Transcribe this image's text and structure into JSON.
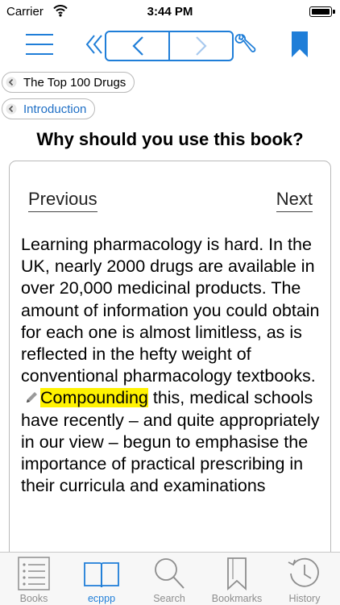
{
  "status_bar": {
    "carrier": "Carrier",
    "time": "3:44 PM"
  },
  "toolbar": {
    "icons": [
      "hamburger-menu-icon",
      "double-chevron-left-icon",
      "chevron-left-icon",
      "chevron-right-icon",
      "wrench-icon",
      "bookmark-icon"
    ]
  },
  "breadcrumbs": [
    {
      "label": "The Top 100 Drugs"
    },
    {
      "label": "Introduction"
    }
  ],
  "page": {
    "title": "Why should you use this book?",
    "previous_label": "Previous",
    "next_label": "Next",
    "body_before": "Learning pharmacology is hard. In the UK, nearly 2000 drugs are available in over 20,000 medicinal products. The amount of information you could obtain for each one is almost limitless, as is reflected in the hefty weight of conventional pharmacology textbooks.",
    "highlight": "Compounding",
    "body_after": " this, medical schools have recently – and quite appropriately in our view – begun to emphasise the importance of practical prescribing in their curricula and examinations"
  },
  "tabs": [
    {
      "label": "Books",
      "icon": "list-icon"
    },
    {
      "label": "ecppp",
      "icon": "open-book-icon",
      "active": true
    },
    {
      "label": "Search",
      "icon": "magnifier-icon"
    },
    {
      "label": "Bookmarks",
      "icon": "bookmarks-icon"
    },
    {
      "label": "History",
      "icon": "clock-icon"
    }
  ],
  "colors": {
    "accent": "#1f7ed8",
    "highlight": "#fff200",
    "inactive_tab": "#8e8e8e"
  }
}
